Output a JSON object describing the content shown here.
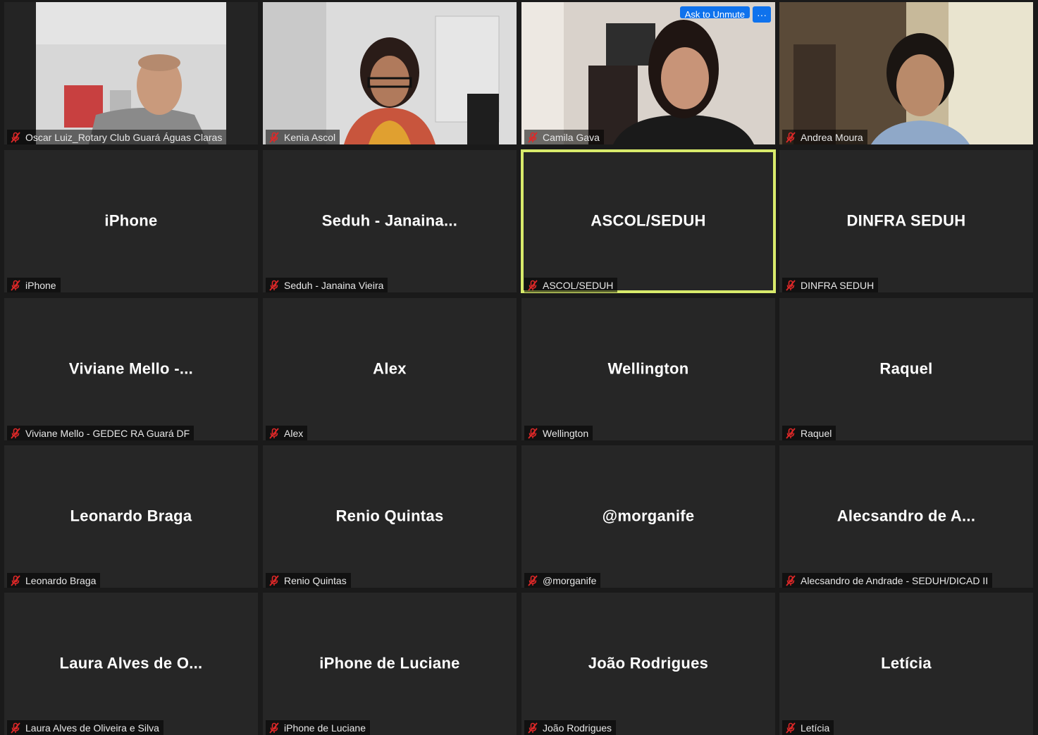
{
  "meeting": {
    "ask_to_unmute_label": "Ask to Unmute",
    "more_label": "···",
    "muted_icon": "mic-muted-icon",
    "active_speaker_color": "#d8ea6b",
    "accent_color": "#0e72ed"
  },
  "video_participants": [
    {
      "label": "Oscar Luiz_Rotary Club Guará Águas Claras"
    },
    {
      "label": "Kenia Ascol"
    },
    {
      "label": "Camila Gava"
    },
    {
      "label": "Andrea Moura"
    }
  ],
  "name_participants": [
    {
      "display": "iPhone",
      "label": "iPhone"
    },
    {
      "display": "Seduh - Janaina...",
      "label": "Seduh - Janaina Vieira"
    },
    {
      "display": "ASCOL/SEDUH",
      "label": "ASCOL/SEDUH"
    },
    {
      "display": "DINFRA SEDUH",
      "label": "DINFRA SEDUH"
    },
    {
      "display": "Viviane Mello -...",
      "label": "Viviane Mello - GEDEC RA Guará DF"
    },
    {
      "display": "Alex",
      "label": "Alex"
    },
    {
      "display": "Wellington",
      "label": "Wellington"
    },
    {
      "display": "Raquel",
      "label": "Raquel"
    },
    {
      "display": "Leonardo Braga",
      "label": "Leonardo Braga"
    },
    {
      "display": "Renio Quintas",
      "label": "Renio Quintas"
    },
    {
      "display": "@morganife",
      "label": "@morganife"
    },
    {
      "display": "Alecsandro de A...",
      "label": "Alecsandro de Andrade - SEDUH/DICAD II"
    },
    {
      "display": "Laura Alves de O...",
      "label": "Laura Alves de Oliveira e Silva"
    },
    {
      "display": "iPhone de Luciane",
      "label": "iPhone de Luciane"
    },
    {
      "display": "João Rodrigues",
      "label": "João Rodrigues"
    },
    {
      "display": "Letícia",
      "label": "Letícia"
    }
  ]
}
